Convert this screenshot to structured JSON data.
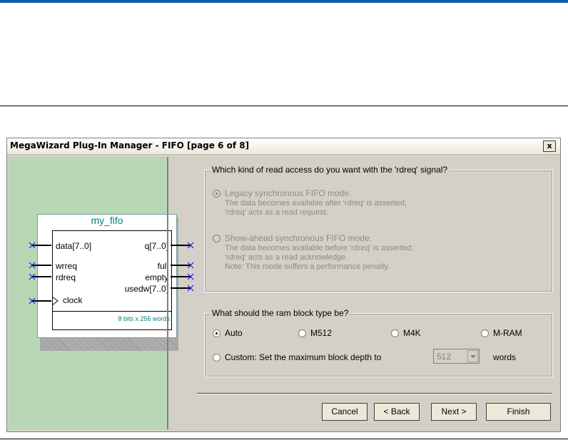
{
  "window": {
    "title": "MegaWizard Plug-In Manager - FIFO [page 6 of 8]",
    "close_label": "x"
  },
  "symbol": {
    "name": "my_fifo",
    "inputs": [
      "data[7..0]",
      "wrreq",
      "rdreq",
      "clock"
    ],
    "outputs": [
      "q[7..0]",
      "full",
      "empty",
      "usedw[7..0]"
    ],
    "size_note": "8 bits x 256 words"
  },
  "read_access": {
    "group_label": "Which kind of read access do you want with the 'rdreq' signal?",
    "options": [
      {
        "label": "Legacy synchronous FIFO mode.",
        "lines": [
          "The data becomes available after 'rdreq' is asserted;",
          "'rdreq' acts as a read request."
        ],
        "selected": true,
        "enabled": false
      },
      {
        "label": "Show-ahead synchronous FIFO mode.",
        "lines": [
          "The data becomes available before 'rdreq' is asserted;",
          "'rdreq' acts as a read acknowledge.",
          "Note: This mode suffers a performance penalty."
        ],
        "selected": false,
        "enabled": false
      }
    ]
  },
  "ram_block": {
    "group_label": "What should the ram block type be?",
    "options": [
      "Auto",
      "M512",
      "M4K",
      "M-RAM"
    ],
    "selected": "Auto",
    "custom_label": "Custom: Set the maximum block depth to",
    "depth_value": "512",
    "words_label": "words"
  },
  "buttons": {
    "cancel": "Cancel",
    "back": "< Back",
    "next": "Next >",
    "finish": "Finish"
  },
  "colors": {
    "accent_bar": "#0b5cb0",
    "left_pane": "#b8d8b5",
    "symbol_teal": "#008080",
    "port_blue": "#0000ff"
  }
}
